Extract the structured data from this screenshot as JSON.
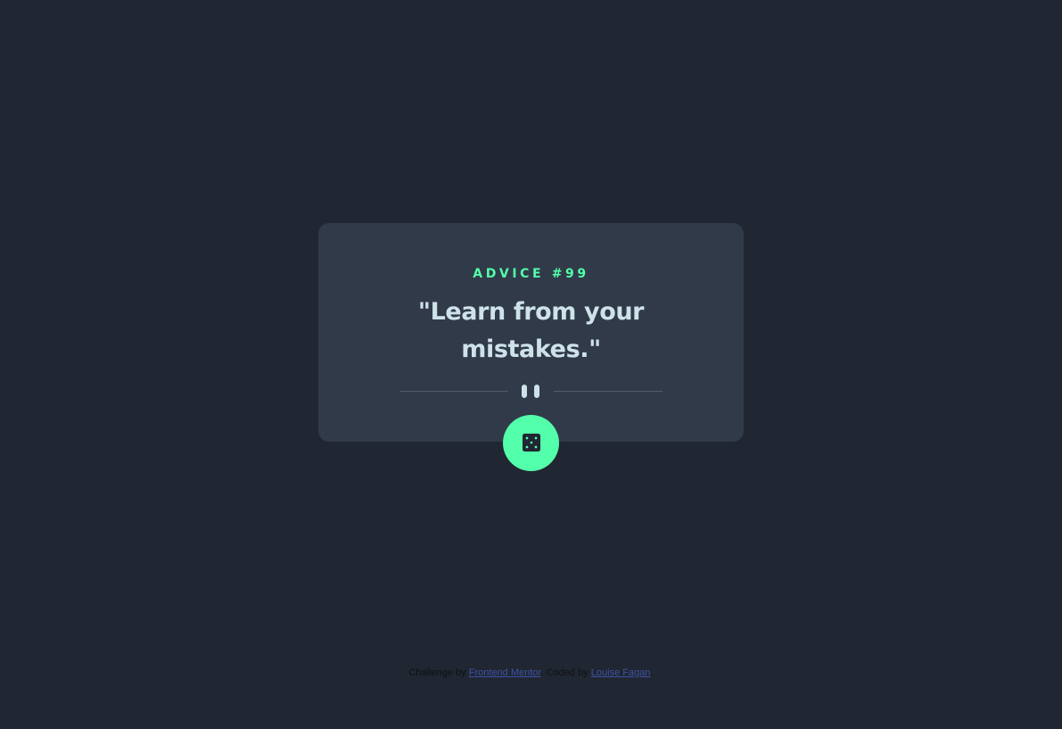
{
  "advice": {
    "id_label": "ADVICE #99",
    "quote": "\"Learn from your mistakes.\""
  },
  "icons": {
    "pause": "pause-icon",
    "dice": "dice-icon"
  },
  "footer": {
    "challenge_by": "Challenge by",
    "frontend_mentor": "Frontend Mentor",
    "separator": ".",
    "coded_by": "Coded by",
    "author": "Louise Fagan",
    "end": "."
  },
  "colors": {
    "background": "#202632",
    "card": "#313A48",
    "accent": "#53FFAA",
    "quote_text": "#CEE3E9"
  }
}
